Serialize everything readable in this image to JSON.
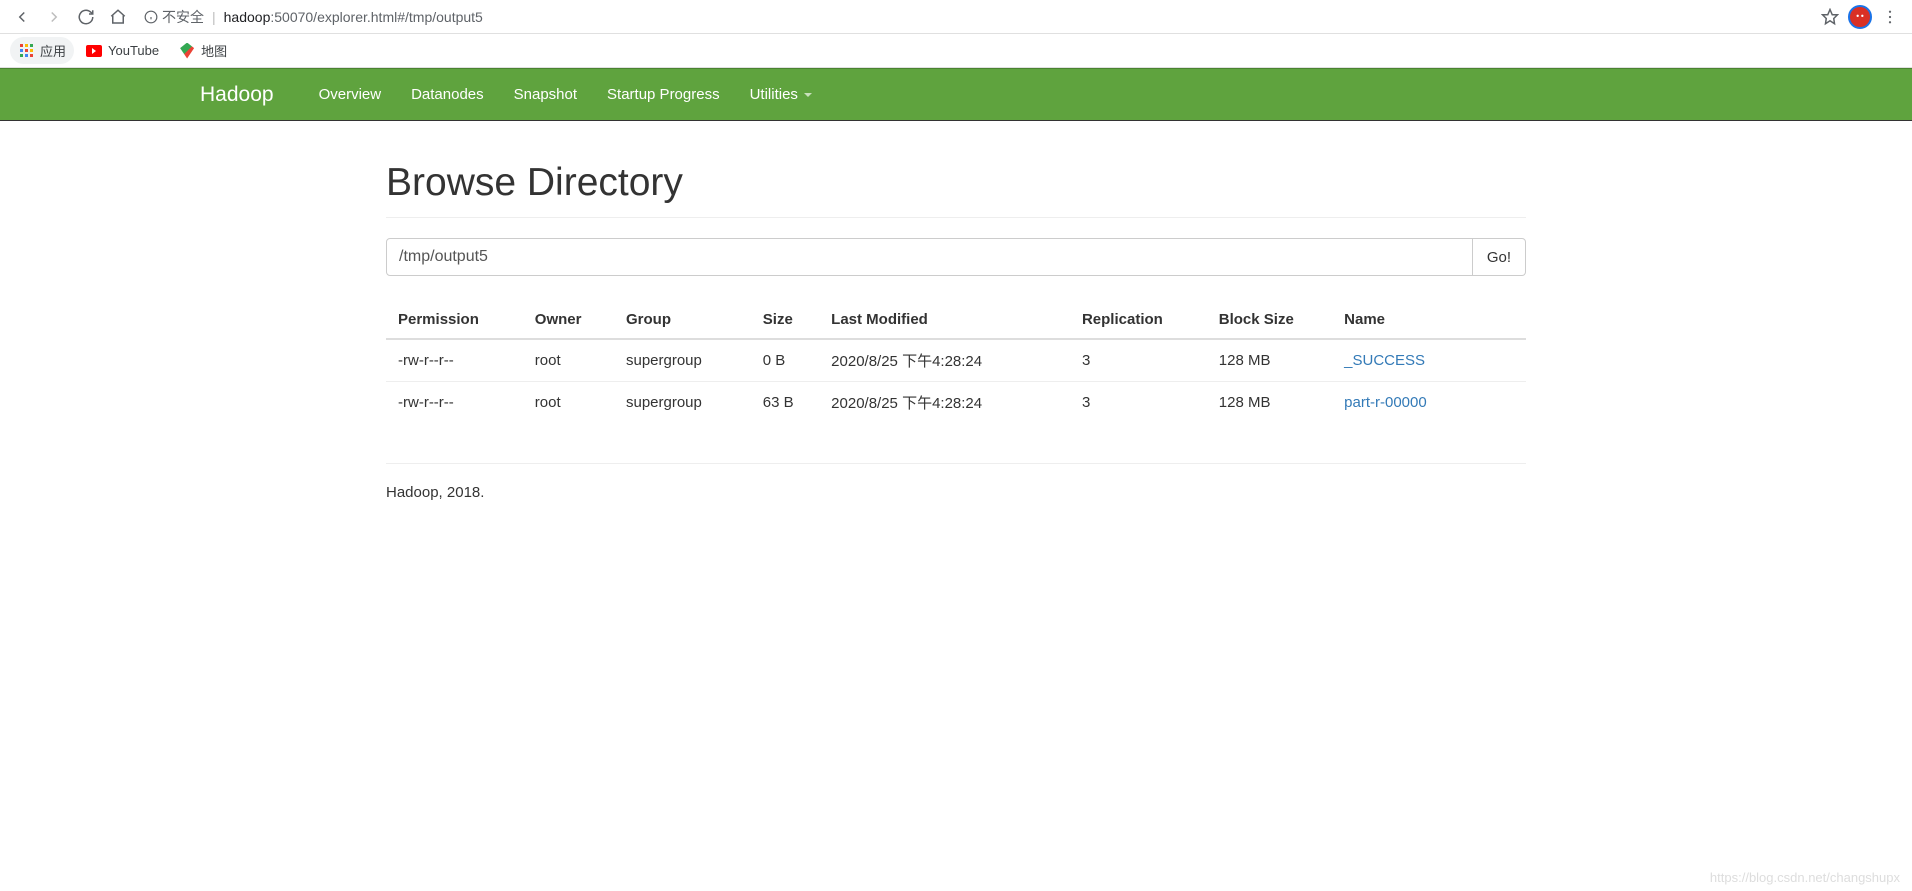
{
  "browser": {
    "insecure_label": "不安全",
    "url_host": "hadoop",
    "url_path": ":50070/explorer.html#/tmp/output5"
  },
  "bookmarks": {
    "apps": "应用",
    "youtube": "YouTube",
    "maps": "地图"
  },
  "navbar": {
    "brand": "Hadoop",
    "links": [
      "Overview",
      "Datanodes",
      "Snapshot",
      "Startup Progress",
      "Utilities"
    ]
  },
  "page": {
    "title": "Browse Directory",
    "path_value": "/tmp/output5",
    "go_label": "Go!",
    "footer": "Hadoop, 2018.",
    "watermark": "https://blog.csdn.net/changshupx"
  },
  "table": {
    "headers": {
      "permission": "Permission",
      "owner": "Owner",
      "group": "Group",
      "size": "Size",
      "last_modified": "Last Modified",
      "replication": "Replication",
      "block_size": "Block Size",
      "name": "Name"
    },
    "rows": [
      {
        "permission": "-rw-r--r--",
        "owner": "root",
        "group": "supergroup",
        "size": "0 B",
        "last_modified": "2020/8/25 下午4:28:24",
        "replication": "3",
        "block_size": "128 MB",
        "name": "_SUCCESS"
      },
      {
        "permission": "-rw-r--r--",
        "owner": "root",
        "group": "supergroup",
        "size": "63 B",
        "last_modified": "2020/8/25 下午4:28:24",
        "replication": "3",
        "block_size": "128 MB",
        "name": "part-r-00000"
      }
    ]
  }
}
